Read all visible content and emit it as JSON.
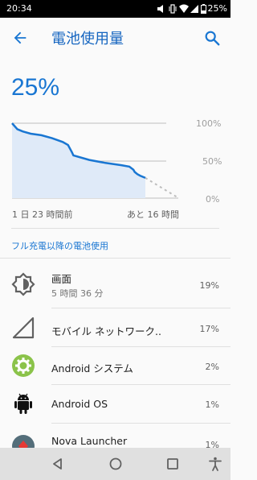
{
  "status": {
    "time": "20:34",
    "battery": "25%"
  },
  "appbar": {
    "title": "電池使用量"
  },
  "battery_level": "25%",
  "chart_data": {
    "type": "line",
    "x_start_label": "1 日 23 時間前",
    "x_end_label": "あと 16 時間",
    "y_ticks": [
      "100%",
      "50%",
      "0%"
    ],
    "ylim": [
      0,
      100
    ],
    "x": [
      0,
      4,
      8,
      14,
      22,
      30,
      38,
      42,
      45,
      46,
      58,
      70,
      82,
      88,
      91,
      92,
      94,
      96,
      100
    ],
    "actual": [
      100,
      92,
      89,
      86,
      84,
      80,
      75,
      71,
      61,
      57,
      51,
      47,
      44,
      42,
      38,
      35,
      32,
      30,
      27
    ],
    "projected": [
      {
        "x": 100,
        "y": 27
      },
      {
        "x": 125,
        "y": 0
      }
    ]
  },
  "section_title": "フル充電以降の電池使用",
  "items": [
    {
      "name": "画面",
      "sub": "5 時間 36 分",
      "percent": "19%",
      "icon": "brightness-icon"
    },
    {
      "name": "モバイル ネットワーク..",
      "sub": "",
      "percent": "17%",
      "icon": "signal-icon"
    },
    {
      "name": "Android システム",
      "sub": "",
      "percent": "2%",
      "icon": "android-system-icon"
    },
    {
      "name": "Android OS",
      "sub": "",
      "percent": "1%",
      "icon": "android-icon"
    },
    {
      "name": "Nova Launcher",
      "sub": "",
      "percent": "1%",
      "icon": "nova-launcher-icon"
    }
  ]
}
